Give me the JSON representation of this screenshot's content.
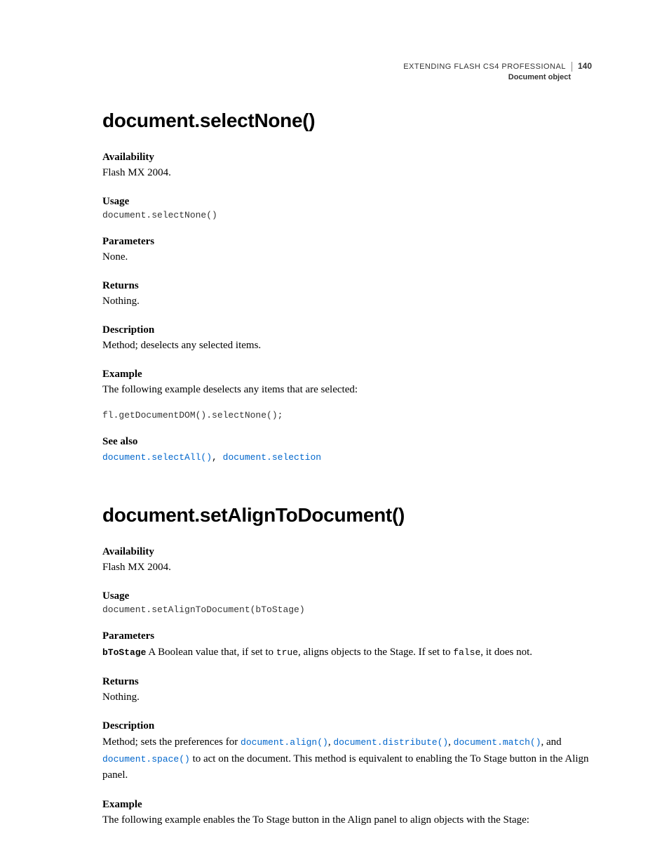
{
  "header": {
    "title": "EXTENDING FLASH CS4 PROFESSIONAL",
    "page": "140",
    "section": "Document object"
  },
  "s1": {
    "heading": "document.selectNone()",
    "availability_label": "Availability",
    "availability_text": "Flash MX 2004.",
    "usage_label": "Usage",
    "usage_code": "document.selectNone()",
    "parameters_label": "Parameters",
    "parameters_text": "None.",
    "returns_label": "Returns",
    "returns_text": "Nothing.",
    "description_label": "Description",
    "description_text": "Method; deselects any selected items.",
    "example_label": "Example",
    "example_text": "The following example deselects any items that are selected:",
    "example_code": "fl.getDocumentDOM().selectNone();",
    "seealso_label": "See also",
    "seealso_link1": "document.selectAll()",
    "seealso_link2": "document.selection"
  },
  "s2": {
    "heading": "document.setAlignToDocument()",
    "availability_label": "Availability",
    "availability_text": "Flash MX 2004.",
    "usage_label": "Usage",
    "usage_code": "document.setAlignToDocument(bToStage)",
    "parameters_label": "Parameters",
    "param_name": "bToStage",
    "param_text1": "  A Boolean value that, if set to ",
    "param_true": "true",
    "param_text2": ", aligns objects to the Stage. If set to ",
    "param_false": "false",
    "param_text3": ", it does not.",
    "returns_label": "Returns",
    "returns_text": "Nothing.",
    "description_label": "Description",
    "desc_t1": "Method; sets the preferences for ",
    "desc_link1": "document.align()",
    "desc_c1": ", ",
    "desc_link2": "document.distribute()",
    "desc_c2": ", ",
    "desc_link3": "document.match()",
    "desc_c3": ", and ",
    "desc_link4": "document.space()",
    "desc_t2": " to act on the document. This method is equivalent to enabling the To Stage button in the Align panel.",
    "example_label": "Example",
    "example_text": "The following example enables the To Stage button in the Align panel to align objects with the Stage:"
  }
}
